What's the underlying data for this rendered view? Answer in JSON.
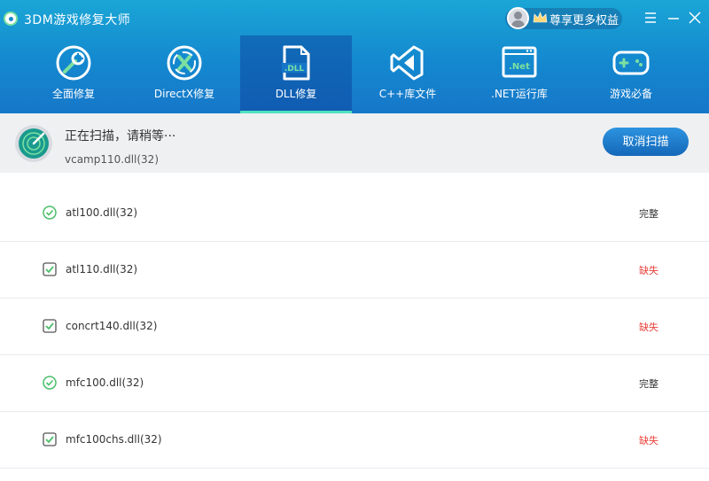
{
  "app": {
    "title": "3DM游戏修复大师",
    "vip_text": "尊享更多权益"
  },
  "colors": {
    "header_top": "#1aa6d6",
    "header_bottom": "#1677c9",
    "active_tab_indicator": "#4fe3c0",
    "ok_green": "#4cbf6a",
    "missing_red": "#e8413a",
    "button_blue": "#1a79c8"
  },
  "tabs": [
    {
      "label": "全面修复",
      "icon": "wrench-repair-icon",
      "active": false
    },
    {
      "label": "DirectX修复",
      "icon": "directx-icon",
      "active": false
    },
    {
      "label": "DLL修复",
      "icon": "dll-file-icon",
      "active": true
    },
    {
      "label": "C++库文件",
      "icon": "visual-cpp-icon",
      "active": false
    },
    {
      "label": ".NET运行库",
      "icon": "dotnet-window-icon",
      "active": false
    },
    {
      "label": "游戏必备",
      "icon": "gamepad-icon",
      "active": false
    }
  ],
  "scan": {
    "status": "正在扫描，请稍等···",
    "current_file": "vcamp110.dll(32)",
    "cancel_label": "取消扫描"
  },
  "files": [
    {
      "name": "atl100.dll(32)",
      "status": "完整",
      "state": "ok"
    },
    {
      "name": "atl110.dll(32)",
      "status": "缺失",
      "state": "missing"
    },
    {
      "name": "concrt140.dll(32)",
      "status": "缺失",
      "state": "missing"
    },
    {
      "name": "mfc100.dll(32)",
      "status": "完整",
      "state": "ok"
    },
    {
      "name": "mfc100chs.dll(32)",
      "status": "缺失",
      "state": "missing"
    }
  ]
}
